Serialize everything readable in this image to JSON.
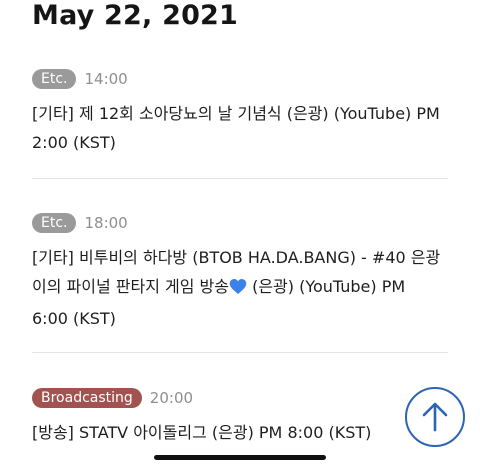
{
  "date_title": "May 22, 2021",
  "events": [
    {
      "category": "Etc.",
      "time": "14:00",
      "text": "[기타] 제 12회 소아당뇨의 날 기념식 (은광) (YouTube) PM 2:00 (KST)"
    },
    {
      "category": "Etc.",
      "time": "18:00",
      "text_before": "[기타] 비투비의 하다방 (BTOB HA.DA.BANG) - #40 은광이의 파이널 판타지 게임 방송",
      "text_after": " (은광) (YouTube) PM 6:00 (KST)",
      "emoji": "blue-heart-icon"
    },
    {
      "category": "Broadcasting",
      "time": "20:00",
      "text": "[방송] STATV 아이돌리그 (은광) PM 8:00 (KST)"
    }
  ],
  "colors": {
    "etc_badge": "#9a9a9a",
    "broadcasting_badge": "#a3534f",
    "scroll_button": "#2b63b7",
    "heart": "#3b82e8"
  },
  "icons": {
    "scroll_top": "arrow-up-icon"
  }
}
